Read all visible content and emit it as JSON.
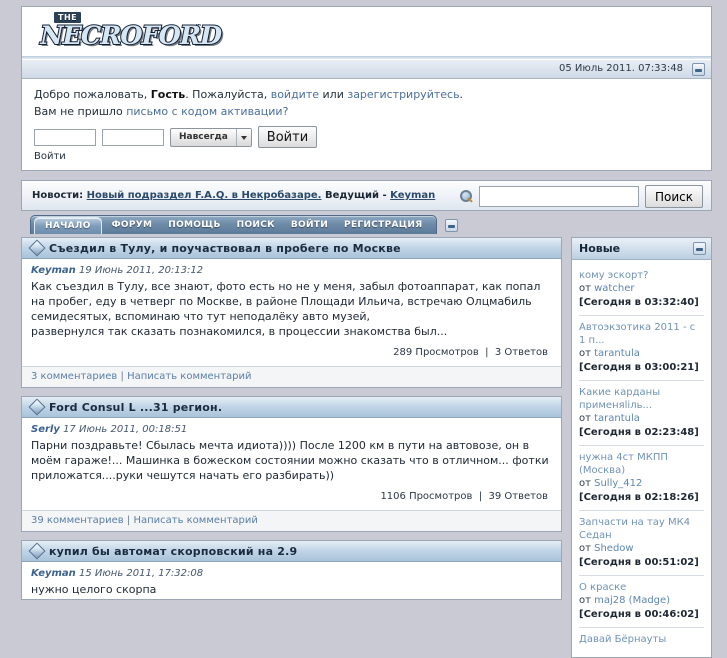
{
  "site": {
    "logo_the": "THE",
    "logo_word": "NECROFORD",
    "logo_tm": "™",
    "datetime": "05 Июль 2011. 07:33:48"
  },
  "login": {
    "welcome_prefix": "Добро пожаловать, ",
    "welcome_user": "Гость",
    "welcome_mid": ". Пожалуйста, ",
    "login_link": "войдите",
    "or": " или ",
    "register_link": "зарегистрируйтесь",
    "welcome_end": ".",
    "activation_prefix": "Вам не пришло ",
    "activation_link": "письмо с кодом активации?",
    "user_value": "",
    "pass_value": "",
    "duration": "Навсегда",
    "submit_label": "Войти",
    "sub_label": "Войти"
  },
  "news": {
    "label": "Новости: ",
    "link": "Новый подраздел F.A.Q. в Некробазаре.",
    "lead_label": " Ведущий - ",
    "lead_name": "Keyman"
  },
  "search": {
    "value": "",
    "button_label": "Поиск",
    "icon": "search-icon"
  },
  "nav": {
    "tabs": [
      {
        "label": "НАЧАЛО",
        "active": true
      },
      {
        "label": "ФОРУМ",
        "active": false
      },
      {
        "label": "ПОМОЩЬ",
        "active": false
      },
      {
        "label": "ПОИСК",
        "active": false
      },
      {
        "label": "ВОЙТИ",
        "active": false
      },
      {
        "label": "РЕГИСТРАЦИЯ",
        "active": false
      }
    ]
  },
  "posts": [
    {
      "title": "Съездил в Тулу, и поучаствовал в пробеге по Москве",
      "author": "Keyman",
      "date": "19 Июнь 2011, 20:13:12",
      "text": "Как съездил в Тулу, все знают, фото есть но не у меня, забыл фотоаппарат, как попал на пробег, еду в четверг по Москве, в районе Площади Ильича, встречаю Олцмабиль\nсемидесятых, вспоминаю что тут неподалёку авто музей,\nразвернулся так сказать познакомился, в процессии знакомства был...",
      "views": "289 Просмотров",
      "replies": "3 Ответов",
      "comments_link": "3 комментариев",
      "write_link": "Написать комментарий"
    },
    {
      "title": "Ford Consul L ...31 регион.",
      "author": "Serly",
      "date": "17 Июнь 2011, 00:18:51",
      "text": "Парни поздравьте! Сбылась мечта идиота)))) После 1200 км в пути на автовозе, он в моём гараже!... Машинка в божеском состоянии можно сказать что в отличном... фотки приложатся....руки чешутся начать его разбирать))",
      "views": "1106 Просмотров",
      "replies": "39 Ответов",
      "comments_link": "39 комментариев",
      "write_link": "Написать комментарий"
    },
    {
      "title": "купил бы автомат скорповский на 2.9",
      "author": "Keyman",
      "date": "15 Июнь 2011, 17:32:08",
      "text": "нужно целого скорпа",
      "views": "",
      "replies": "",
      "comments_link": "",
      "write_link": ""
    }
  ],
  "sidebar": {
    "title": "Новые",
    "items": [
      {
        "subject": "кому эскорт?",
        "by_label": "от ",
        "by": "watcher",
        "time": "[Сегодня в 03:32:40]"
      },
      {
        "subject": "Автоэкзотика 2011 - с 1 п...",
        "by_label": "от ",
        "by": "tarantula",
        "time": "[Сегодня в 03:00:21]"
      },
      {
        "subject": "Какие карданы применяliль...",
        "by_label": "от ",
        "by": "tarantula",
        "time": "[Сегодня в 02:23:48]"
      },
      {
        "subject": "нужна 4ст МКПП (Москва)",
        "by_label": "от ",
        "by": "Sully_412",
        "time": "[Сегодня в 02:18:26]"
      },
      {
        "subject": "Запчасти на тау МК4 Седан",
        "by_label": "от ",
        "by": "Shedow",
        "time": "[Сегодня в 00:51:02]"
      },
      {
        "subject": "О краске",
        "by_label": "от ",
        "by": "maj28 (Madge)",
        "time": "[Сегодня в 00:46:02]"
      },
      {
        "subject": "Давай Бёрнауты",
        "by_label": "",
        "by": "",
        "time": ""
      }
    ]
  },
  "colors": {
    "page_bg": "#c9cad4",
    "header_dark": "#3c5f81",
    "header_light": "#9fb7cd",
    "link": "#4a6f9e",
    "tab_active": "#7e9cba"
  }
}
